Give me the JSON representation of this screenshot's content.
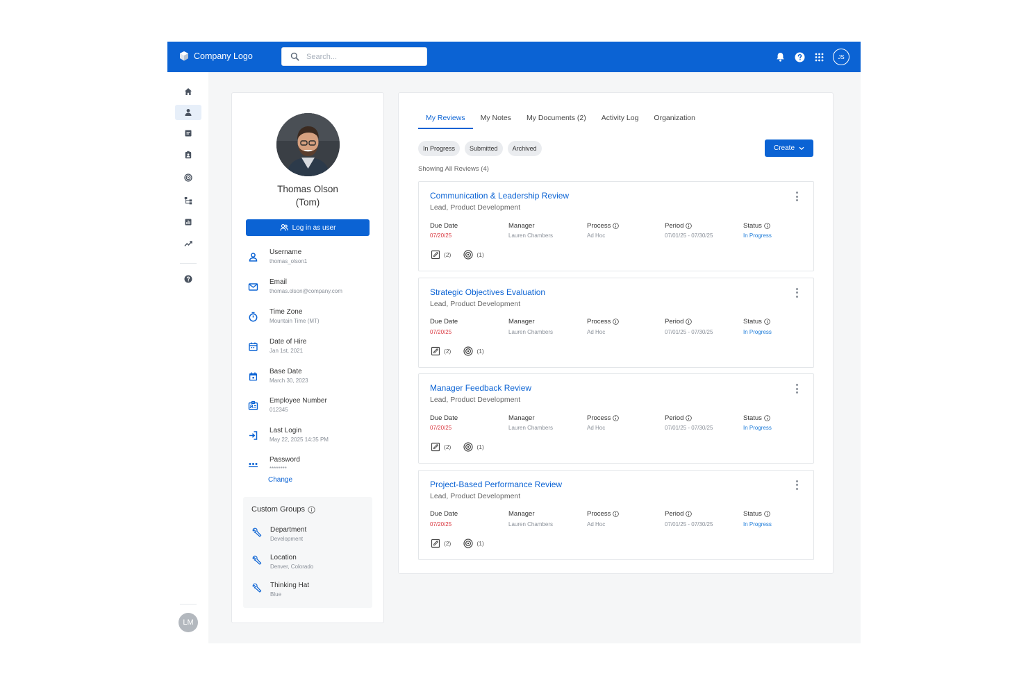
{
  "colors": {
    "brand": "#0b63d4",
    "due": "#d9363e",
    "status": "#1a7ad9"
  },
  "header": {
    "logo_text": "Company Logo",
    "search_placeholder": "Search...",
    "user_initials": "JS",
    "icons": [
      "bell-icon",
      "help-icon",
      "apps-grid-icon"
    ]
  },
  "sidebar": {
    "items": [
      {
        "icon": "home-icon",
        "active": false
      },
      {
        "icon": "person-icon",
        "active": true
      },
      {
        "icon": "notes-icon",
        "active": false
      },
      {
        "icon": "badge-icon",
        "active": false
      },
      {
        "icon": "target-icon",
        "active": false
      },
      {
        "icon": "org-chart-icon",
        "active": false
      },
      {
        "icon": "bar-chart-icon",
        "active": false
      },
      {
        "icon": "trend-icon",
        "active": false
      },
      {
        "icon": "help-icon",
        "active": false
      }
    ],
    "bottom_avatar": "LM"
  },
  "profile": {
    "name_line1": "Thomas Olson",
    "name_line2": "(Tom)",
    "login_button": "Log in as user",
    "fields": [
      {
        "label": "Username",
        "value": "thomas_olson1",
        "icon": "person-icon"
      },
      {
        "label": "Email",
        "value": "thomas.olson@company.com",
        "icon": "mail-icon"
      },
      {
        "label": "Time Zone",
        "value": "Mountain Time (MT)",
        "icon": "stopwatch-icon"
      },
      {
        "label": "Date of Hire",
        "value": "Jan 1st, 2021",
        "icon": "calendar-icon"
      },
      {
        "label": "Base Date",
        "value": "March 30, 2023",
        "icon": "calendar-event-icon"
      },
      {
        "label": "Employee Number",
        "value": "012345",
        "icon": "id-card-icon"
      },
      {
        "label": "Last Login",
        "value": "May 22, 2025 14:35 PM",
        "icon": "login-arrow-icon"
      },
      {
        "label": "Password",
        "value": "********",
        "icon": "password-dots-icon"
      }
    ],
    "change_link": "Change",
    "custom_groups": {
      "title": "Custom Groups",
      "items": [
        {
          "label": "Department",
          "value": "Development"
        },
        {
          "label": "Location",
          "value": "Denver, Colorado"
        },
        {
          "label": "Thinking Hat",
          "value": "Blue"
        }
      ]
    }
  },
  "main": {
    "tabs": [
      {
        "label": "My Reviews",
        "active": true
      },
      {
        "label": "My Notes",
        "active": false
      },
      {
        "label": "My Documents (2)",
        "active": false
      },
      {
        "label": "Activity Log",
        "active": false
      },
      {
        "label": "Organization",
        "active": false
      }
    ],
    "filters": [
      "In Progress",
      "Submitted",
      "Archived"
    ],
    "create_button": "Create",
    "showing_text": "Showing All Reviews (4)",
    "column_labels": {
      "due_date": "Due Date",
      "manager": "Manager",
      "process": "Process",
      "period": "Period",
      "status": "Status"
    },
    "reviews": [
      {
        "title": "Communication & Leadership Review",
        "subtitle": "Lead, Product Development",
        "due_date": "07/20/25",
        "manager": "Lauren Chambers",
        "process": "Ad Hoc",
        "period": "07/01/25 - 07/30/25",
        "status": "In Progress",
        "notes_count": "(2)",
        "goals_count": "(1)"
      },
      {
        "title": "Strategic Objectives Evaluation",
        "subtitle": "Lead, Product Development",
        "due_date": "07/20/25",
        "manager": "Lauren Chambers",
        "process": "Ad Hoc",
        "period": "07/01/25 - 07/30/25",
        "status": "In Progress",
        "notes_count": "(2)",
        "goals_count": "(1)"
      },
      {
        "title": "Manager Feedback Review",
        "subtitle": "Lead, Product Development",
        "due_date": "07/20/25",
        "manager": "Lauren Chambers",
        "process": "Ad Hoc",
        "period": "07/01/25 - 07/30/25",
        "status": "In Progress",
        "notes_count": "(2)",
        "goals_count": "(1)"
      },
      {
        "title": "Project-Based Performance Review",
        "subtitle": "Lead, Product Development",
        "due_date": "07/20/25",
        "manager": "Lauren Chambers",
        "process": "Ad Hoc",
        "period": "07/01/25 - 07/30/25",
        "status": "In Progress",
        "notes_count": "(2)",
        "goals_count": "(1)"
      }
    ]
  }
}
